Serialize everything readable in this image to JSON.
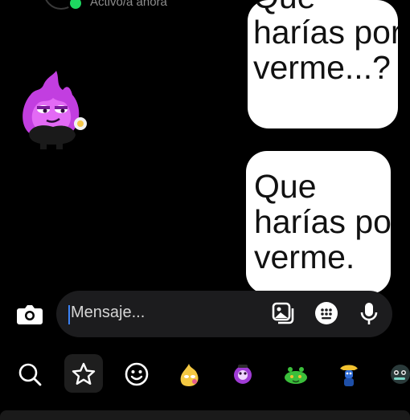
{
  "header": {
    "status_text": "Activo/a ahora"
  },
  "messages": [
    {
      "lines": [
        "Que",
        "harías por",
        "verme...?"
      ]
    },
    {
      "lines": [
        "Que",
        "harías por",
        "verme."
      ]
    }
  ],
  "composer": {
    "placeholder": "Mensaje..."
  },
  "toolbar": {
    "items": [
      "search-icon",
      "star-icon",
      "smiley-icon",
      "sticker-1",
      "sticker-2",
      "sticker-3",
      "sticker-4",
      "sticker-5"
    ]
  },
  "colors": {
    "background": "#000000",
    "online": "#1ed760",
    "bubble": "#ffffff",
    "composer": "#1c1c1e",
    "cursor": "#3b82f6"
  }
}
